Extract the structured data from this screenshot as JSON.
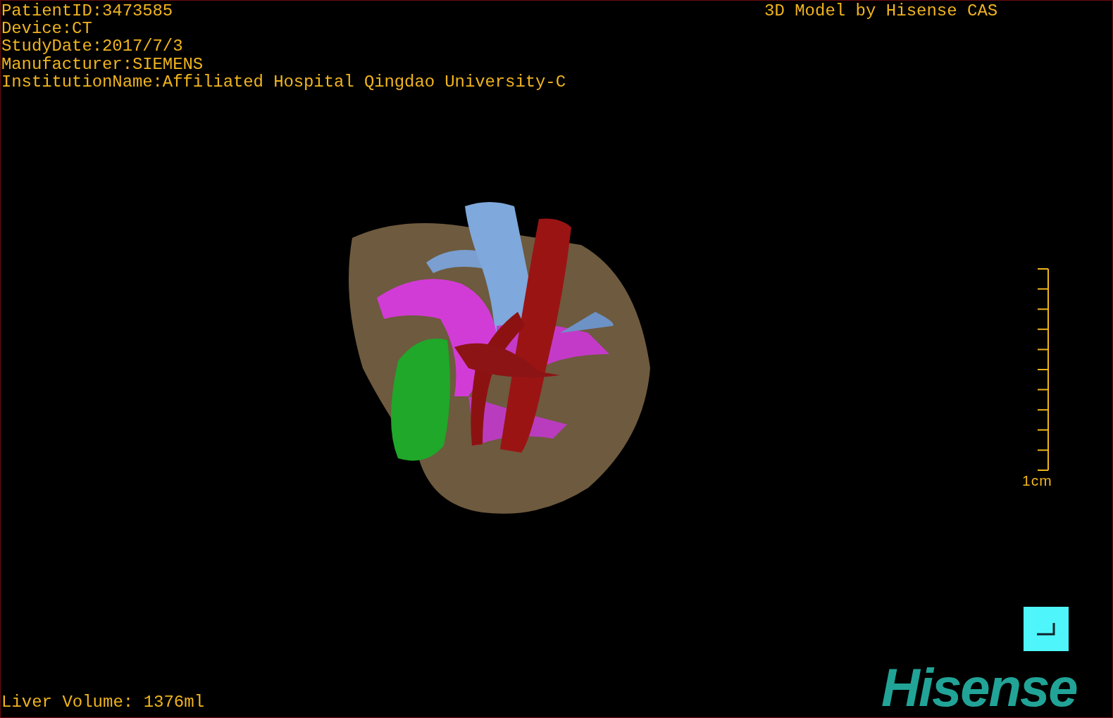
{
  "study_info": [
    "PatientID:3473585",
    "Device:CT",
    "StudyDate:2017/7/3",
    "Manufacturer:SIEMENS",
    "InstitutionName:Affiliated Hospital Qingdao University-C"
  ],
  "header_right": "3D Model by Hisense CAS",
  "scale_bar": {
    "label": "1cm"
  },
  "liver_volume": "Liver Volume: 1376ml",
  "logo": "Hisense"
}
